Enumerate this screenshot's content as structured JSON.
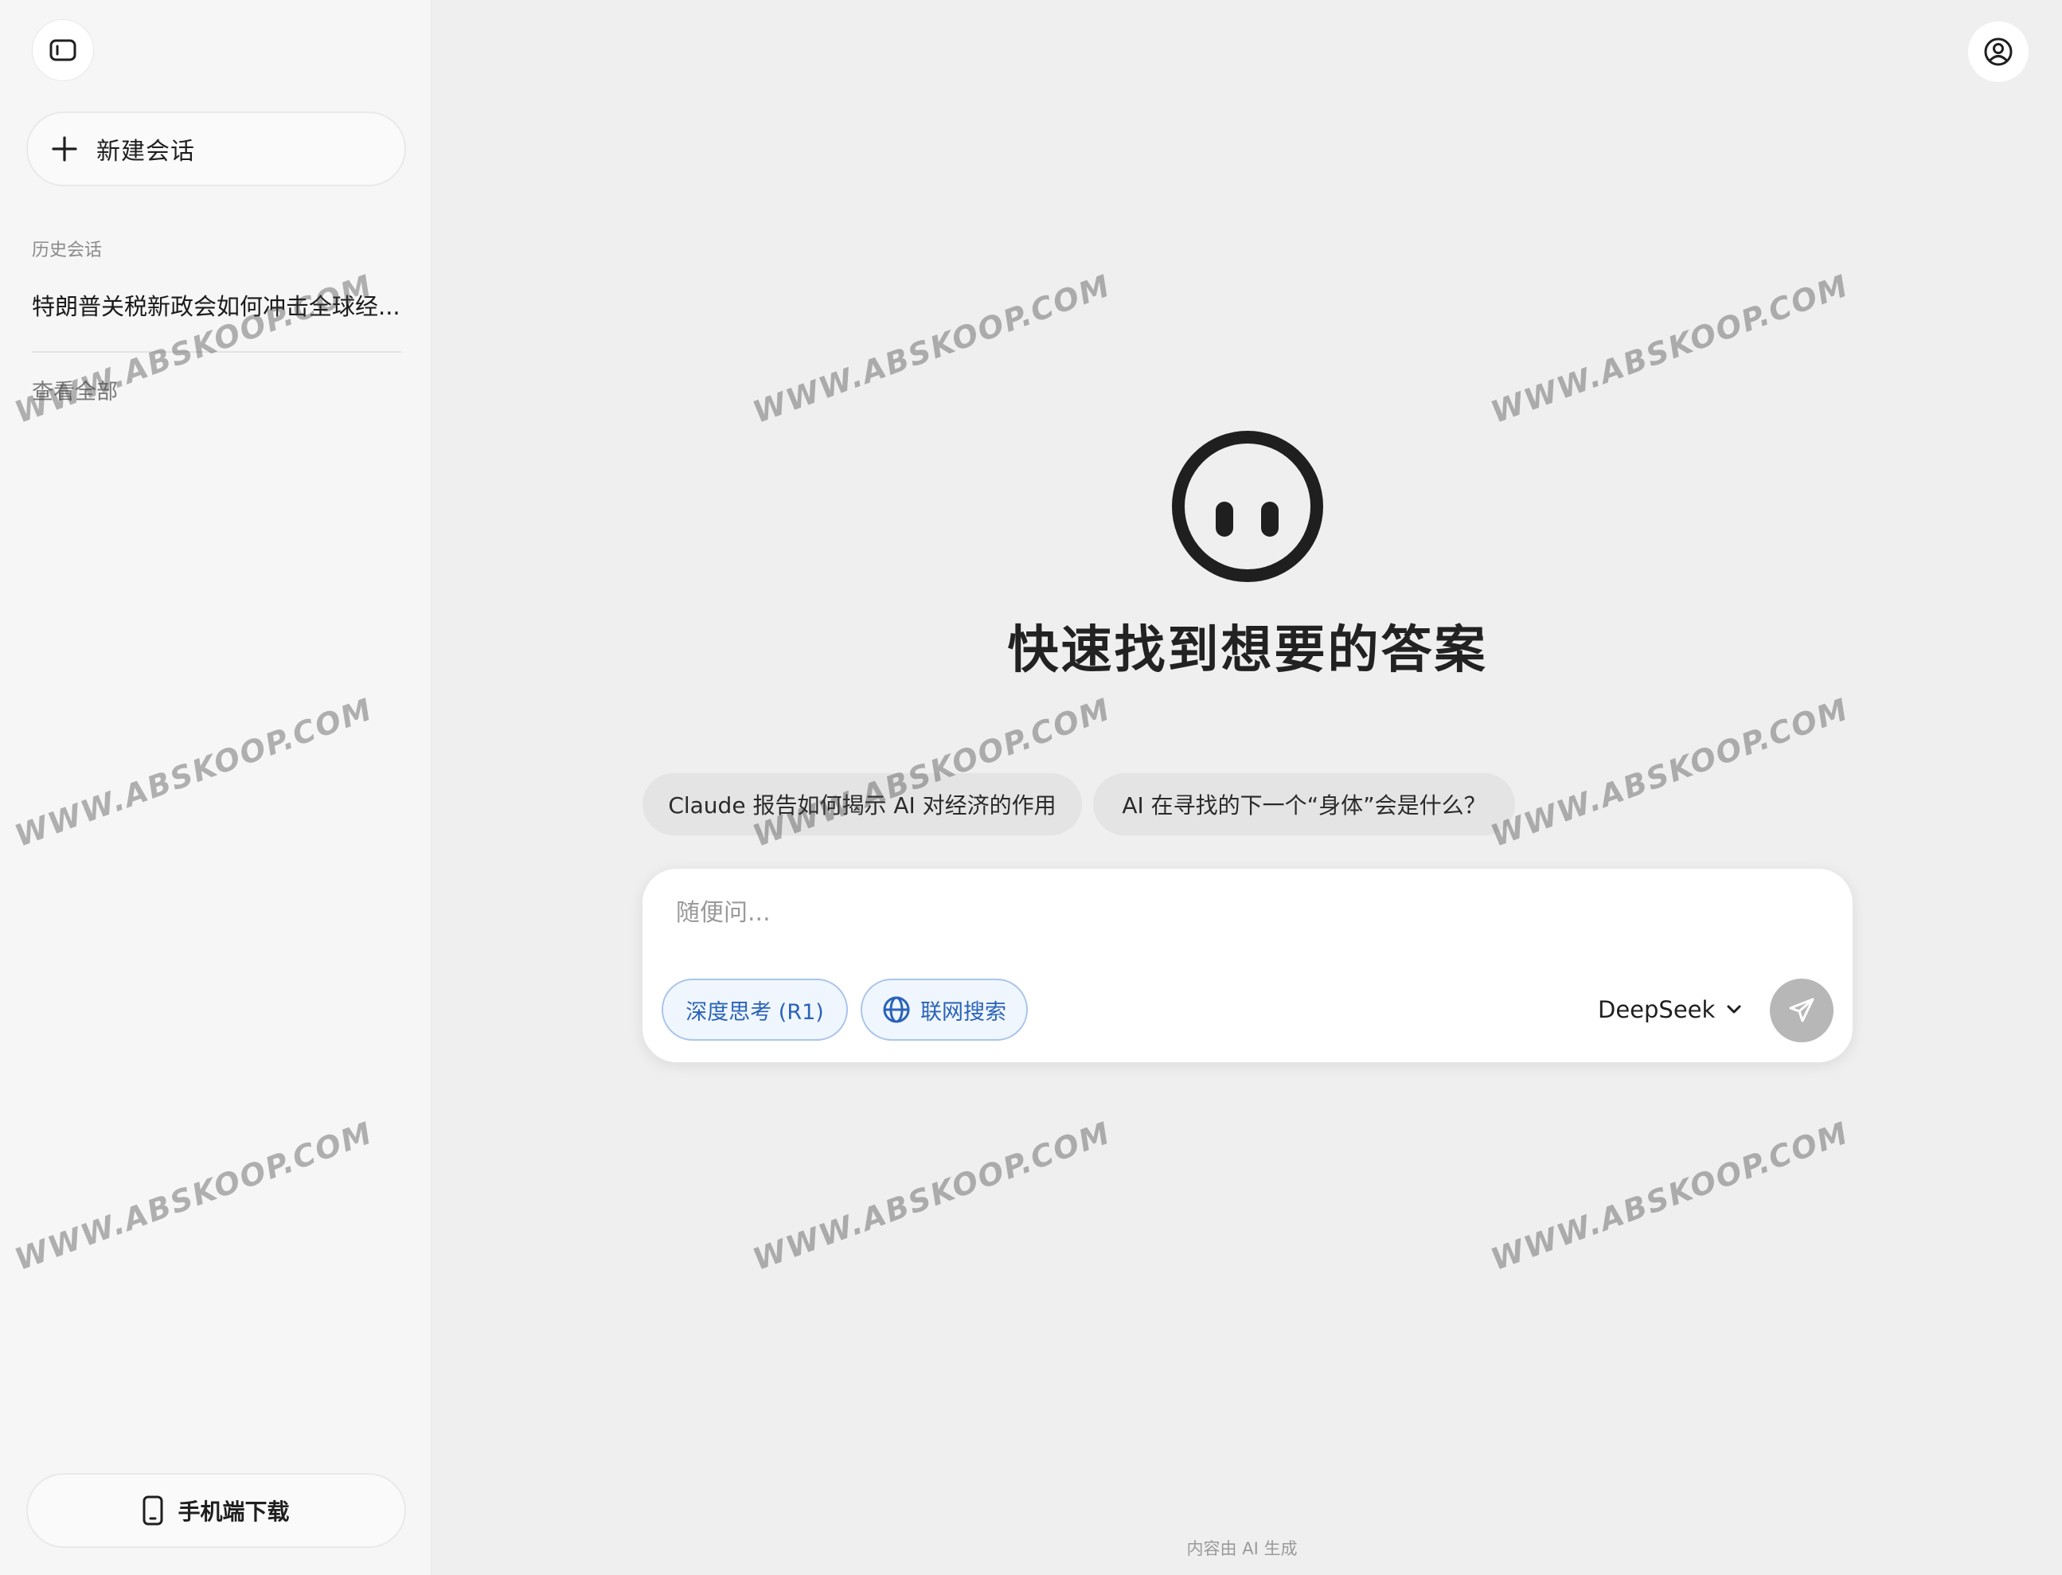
{
  "sidebar": {
    "new_chat_label": "新建会话",
    "history_title": "历史会话",
    "history_items": [
      {
        "title": "特朗普关税新政会如何冲击全球经..."
      }
    ],
    "view_all_label": "查看全部",
    "download_label": "手机端下载"
  },
  "main": {
    "headline": "快速找到想要的答案",
    "suggestions": [
      "Claude 报告如何揭示 AI 对经济的作用",
      "AI 在寻找的下一个“身体”会是什么？"
    ],
    "input": {
      "placeholder": "随便问...",
      "value": ""
    },
    "deep_think_label": "深度思考 (R1)",
    "web_search_label": "联网搜索",
    "model": "DeepSeek",
    "footer_note": "内容由 AI 生成"
  },
  "watermark": {
    "text": "WWW.ABSKOOP.COM"
  },
  "colors": {
    "main_bg": "#efefef",
    "sidebar_bg": "#f6f6f6",
    "accent_blue": "#2a63b8",
    "send_disabled": "#b7b7b7"
  },
  "icons": {
    "sidebar_toggle": "sidebar-toggle-icon",
    "new_chat": "plus-icon",
    "download": "phone-icon",
    "user": "user-icon",
    "logo": "face-logo-icon",
    "web_search": "globe-icon",
    "model_dropdown": "chevron-down-icon",
    "send": "send-icon"
  }
}
